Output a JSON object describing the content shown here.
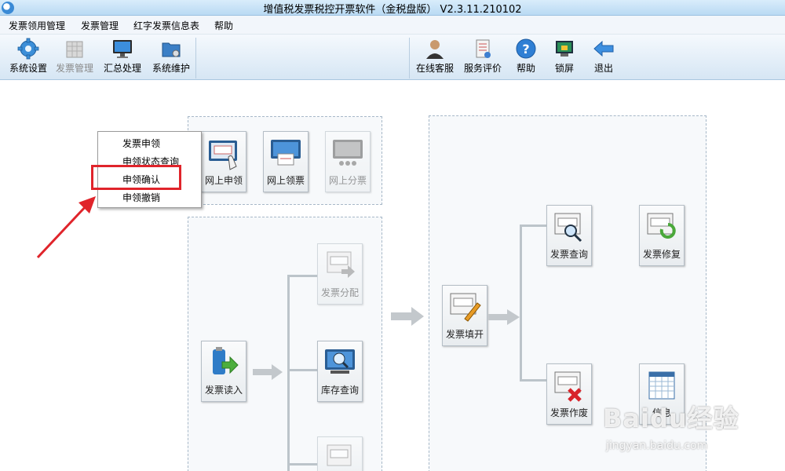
{
  "window": {
    "title": "增值税发票税控开票软件（金税盘版） V2.3.11.210102"
  },
  "menu": [
    "发票领用管理",
    "发票管理",
    "红字发票信息表",
    "帮助"
  ],
  "toolbar": {
    "left": [
      {
        "label": "系统设置",
        "icon": "gear-icon",
        "enabled": true
      },
      {
        "label": "发票管理",
        "icon": "invoice-grid-icon",
        "enabled": false
      },
      {
        "label": "汇总处理",
        "icon": "monitor-icon",
        "enabled": true
      },
      {
        "label": "系统维护",
        "icon": "folder-gear-icon",
        "enabled": true
      }
    ],
    "right": [
      {
        "label": "在线客服",
        "icon": "person-icon"
      },
      {
        "label": "服务评价",
        "icon": "document-icon"
      },
      {
        "label": "帮助",
        "icon": "question-icon"
      },
      {
        "label": "锁屏",
        "icon": "lock-icon"
      },
      {
        "label": "退出",
        "icon": "exit-arrow-icon"
      }
    ]
  },
  "dropdown": {
    "items": [
      "发票申领",
      "申领状态查询",
      "申领确认",
      "申领撤销"
    ],
    "highlighted_index": 2
  },
  "tiles": {
    "online_apply": "网上申领",
    "online_receive": "网上领票",
    "online_distribute": "网上分票",
    "invoice_read": "发票读入",
    "invoice_distribute": "发票分配",
    "stock_query": "库存查询",
    "invoice_fill": "发票填开",
    "invoice_query": "发票查询",
    "invoice_repair": "发票修复",
    "invoice_void": "发票作废",
    "info_table": "信息"
  },
  "watermark": {
    "logo": "Baidu经验",
    "url": "jingyan.baidu.com"
  },
  "colors": {
    "highlight": "#e0242b",
    "arrow": "#e0242b",
    "title_bar": "#c9e3f7"
  }
}
